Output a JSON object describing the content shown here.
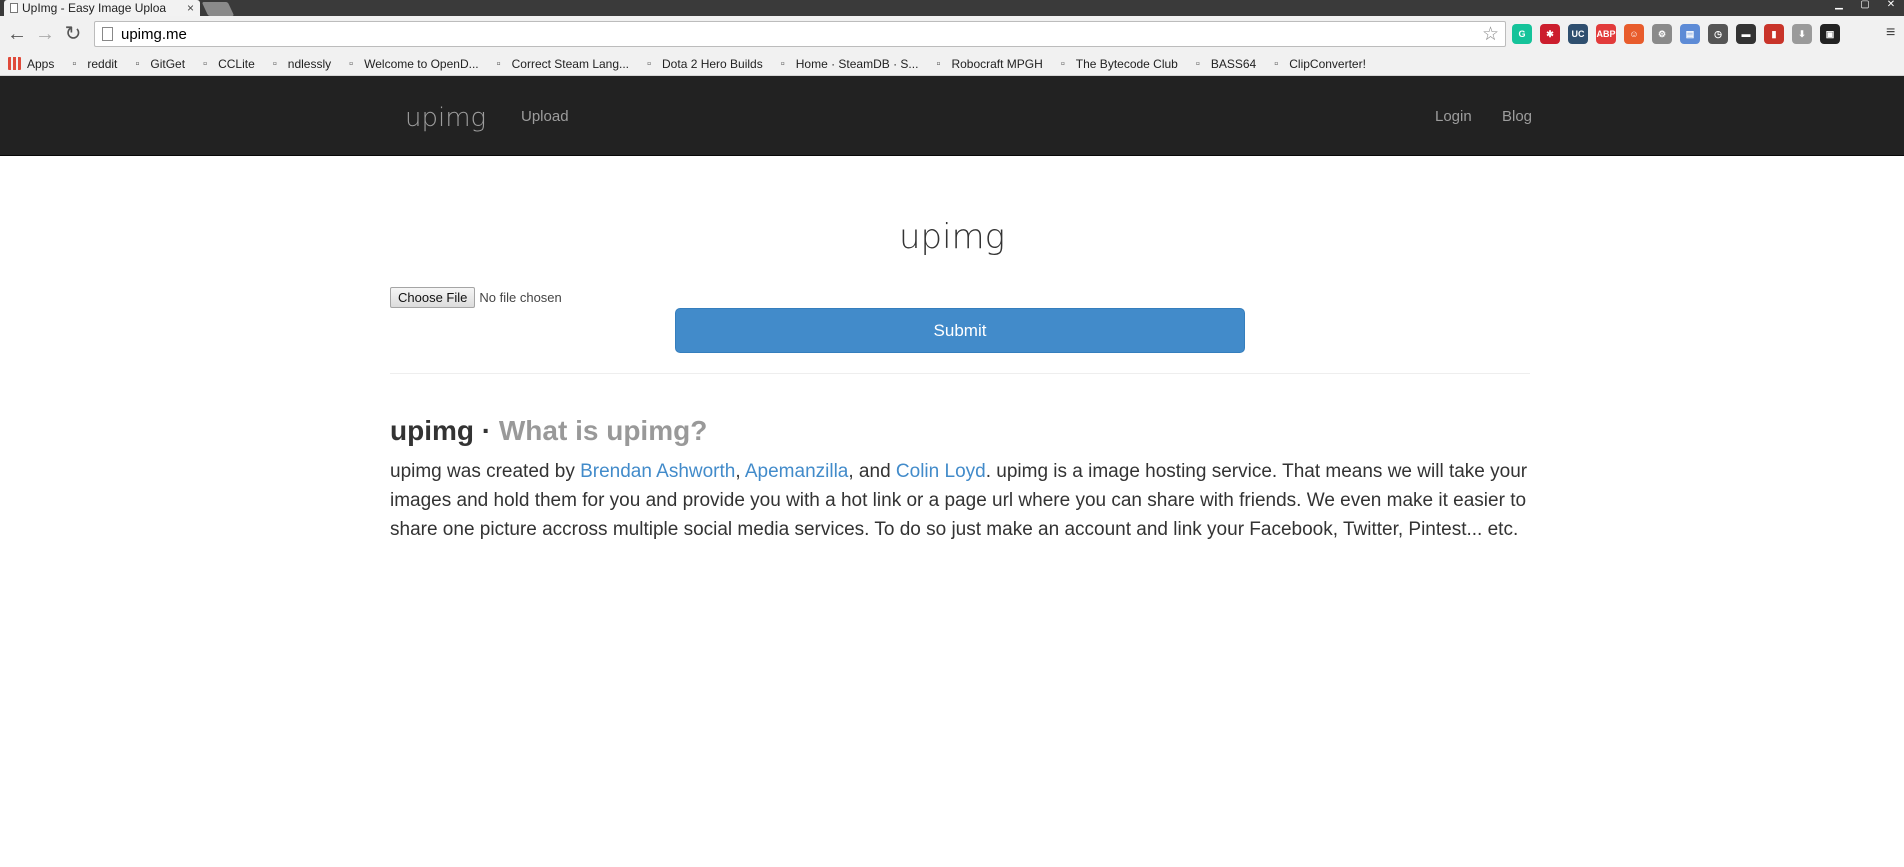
{
  "browser": {
    "tab_title": "UpImg - Easy Image Uploa",
    "tab_close": "×",
    "address_url": "upimg.me",
    "bookmarks": [
      {
        "label": "Apps",
        "icon": "apps-grid-icon"
      },
      {
        "label": "reddit",
        "icon": "reddit-icon"
      },
      {
        "label": "GitGet",
        "icon": "terminal-icon"
      },
      {
        "label": "CCLite",
        "icon": "terminal-icon"
      },
      {
        "label": "ndlessly",
        "icon": "wordpress-icon"
      },
      {
        "label": "Welcome to OpenD...",
        "icon": "opendns-icon"
      },
      {
        "label": "Correct Steam Lang...",
        "icon": "steam-icon"
      },
      {
        "label": "Dota 2 Hero Builds",
        "icon": "dota-icon"
      },
      {
        "label": "Home · SteamDB · S...",
        "icon": "steamdb-icon"
      },
      {
        "label": "Robocraft MPGH",
        "icon": "mpgh-icon"
      },
      {
        "label": "The Bytecode Club",
        "icon": "java-icon"
      },
      {
        "label": "BASS64",
        "icon": "page-icon"
      },
      {
        "label": "ClipConverter!",
        "icon": "page-icon"
      }
    ],
    "extension_icons": [
      {
        "name": "grammarly-icon",
        "color": "#15c39a",
        "glyph": "G"
      },
      {
        "name": "lastpass-icon",
        "color": "#cc1e2d",
        "glyph": "✱"
      },
      {
        "name": "ucl-icon",
        "color": "#2f4f6f",
        "glyph": "UC"
      },
      {
        "name": "adblock-icon",
        "color": "#e23b3b",
        "glyph": "ABP"
      },
      {
        "name": "avatar-ext-icon",
        "color": "#e85c2c",
        "glyph": "☺"
      },
      {
        "name": "settings-ext-icon",
        "color": "#8a8a8a",
        "glyph": "⚙"
      },
      {
        "name": "docs-ext-icon",
        "color": "#5d8bd6",
        "glyph": "▤"
      },
      {
        "name": "clock-ext-icon",
        "color": "#555555",
        "glyph": "◷"
      },
      {
        "name": "mask-ext-icon",
        "color": "#333333",
        "glyph": "▬"
      },
      {
        "name": "book-ext-icon",
        "color": "#c9342a",
        "glyph": "▮"
      },
      {
        "name": "download-ext-icon",
        "color": "#9a9a9a",
        "glyph": "⬇"
      },
      {
        "name": "screen-ext-icon",
        "color": "#222222",
        "glyph": "▣"
      }
    ]
  },
  "site": {
    "brand": "upimg",
    "nav_upload": "Upload",
    "nav_login": "Login",
    "nav_blog": "Blog",
    "hero_title": "upimg",
    "choose_file_label": "Choose File",
    "no_file_text": "No file chosen",
    "submit_label": "Submit",
    "about_title": "upimg ·",
    "about_subtitle": "What is upimg?",
    "about_text_1": "upimg was created by ",
    "author_1": "Brendan Ashworth",
    "sep_1": ", ",
    "author_2": "Apemanzilla",
    "sep_2": ", and ",
    "author_3": "Colin Loyd",
    "about_text_2": ". upimg is a image hosting service. That means we will take your images and hold them for you and provide you with a hot link or a page url where you can share with friends. We even make it easier to share one picture accross multiple social media services. To do so just make an account and link your Facebook, Twitter, Pintest... etc."
  }
}
